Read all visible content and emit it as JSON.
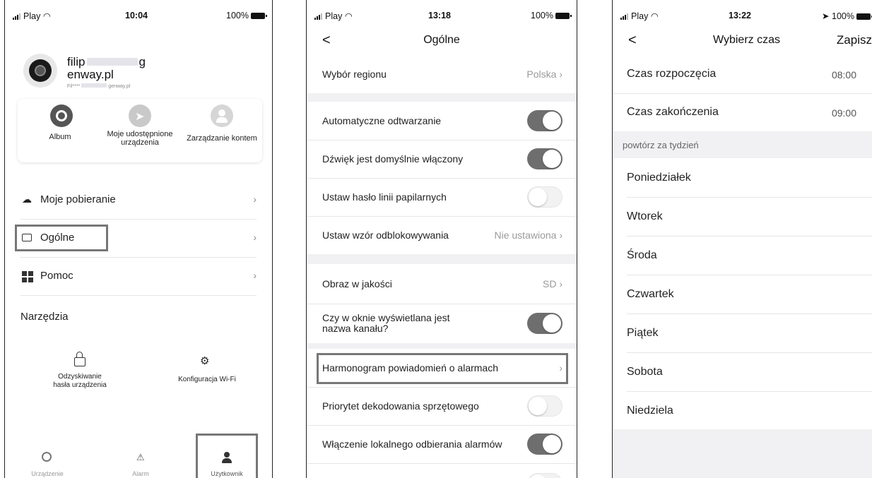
{
  "screen1": {
    "status": {
      "carrier": "Play",
      "time": "10:04",
      "battery": "100%"
    },
    "profile": {
      "name_line1": "filip",
      "name_suffix": "g",
      "name_line2": "enway.pl",
      "email_start": "Fil****",
      "email_end": "genway.pl"
    },
    "quick": [
      {
        "label": "Album"
      },
      {
        "label_line1": "Moje udostępnione",
        "label_line2": "urządzenia"
      },
      {
        "label": "Zarządzanie kontem"
      }
    ],
    "menu": [
      {
        "label": "Moje pobieranie"
      },
      {
        "label": "Ogólne"
      },
      {
        "label": "Pomoc"
      }
    ],
    "tools": {
      "title": "Narzędzia",
      "items": [
        {
          "line1": "Odzyskiwanie",
          "line2": "hasła urządzenia"
        },
        {
          "line1": "Konfiguracja Wi-Fi"
        }
      ]
    },
    "tabs": [
      {
        "label": "Urządzenie"
      },
      {
        "label": "Alarm"
      },
      {
        "label": "Użytkownik"
      }
    ]
  },
  "screen2": {
    "status": {
      "carrier": "Play",
      "time": "13:18",
      "battery": "100%"
    },
    "title": "Ogólne",
    "rows": [
      {
        "label": "Wybór regionu",
        "value": "Polska"
      },
      {
        "label": "Automatyczne odtwarzanie",
        "state": "on"
      },
      {
        "label": "Dźwięk jest domyślnie włączony",
        "state": "on"
      },
      {
        "label": "Ustaw hasło linii papilarnych",
        "state": "off"
      },
      {
        "label": "Ustaw wzór odblokowywania",
        "value": "Nie ustawiona"
      },
      {
        "label": "Obraz w jakości",
        "value": "SD"
      },
      {
        "label_line1": "Czy w oknie wyświetlana jest",
        "label_line2": "nazwa kanału?",
        "state": "on"
      },
      {
        "label": "Harmonogram powiadomień o alarmach"
      },
      {
        "label": "Priorytet dekodowania sprzętowego",
        "state": "off"
      },
      {
        "label": "Włączenie lokalnego odbierania alarmów",
        "state": "on"
      }
    ]
  },
  "screen3": {
    "status": {
      "carrier": "Play",
      "time": "13:22",
      "battery": "100%"
    },
    "title": "Wybierz czas",
    "save": "Zapisz",
    "start": {
      "label": "Czas rozpoczęcia",
      "value": "08:00"
    },
    "end": {
      "label": "Czas zakończenia",
      "value": "09:00"
    },
    "repeat_header": "powtórz za tydzień",
    "days": [
      "Poniedziałek",
      "Wtorek",
      "Środa",
      "Czwartek",
      "Piątek",
      "Sobota",
      "Niedziela"
    ]
  },
  "colors": {
    "highlight": "#777777",
    "toggle_on": "#6e6e6e",
    "toggle_off": "#f2f2f2"
  }
}
